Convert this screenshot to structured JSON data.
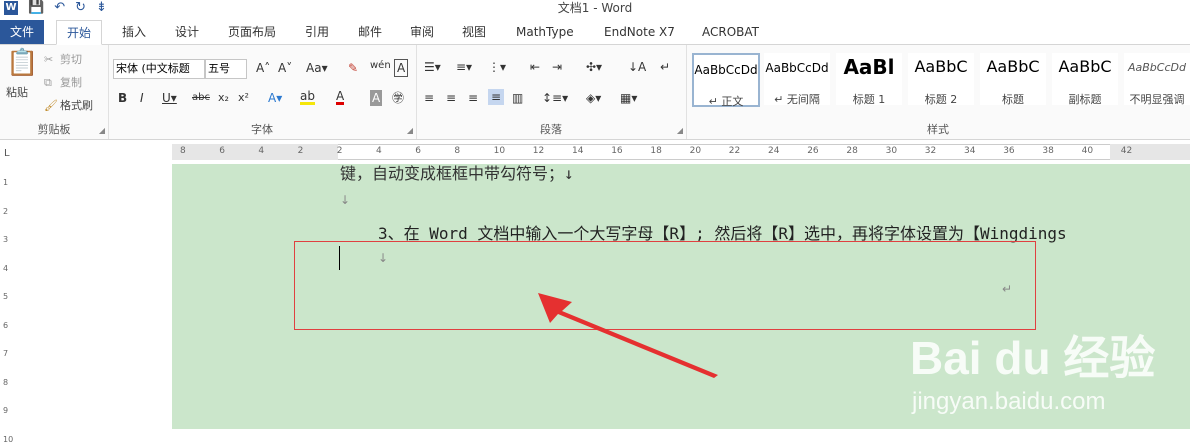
{
  "window": {
    "title": "文档1 - Word"
  },
  "qat": {
    "save": "💾",
    "undo": "↶",
    "redo": "↻",
    "more": "⇟"
  },
  "tabs": [
    {
      "label": "文件"
    },
    {
      "label": "开始"
    },
    {
      "label": "插入"
    },
    {
      "label": "设计"
    },
    {
      "label": "页面布局"
    },
    {
      "label": "引用"
    },
    {
      "label": "邮件"
    },
    {
      "label": "审阅"
    },
    {
      "label": "视图"
    },
    {
      "label": "MathType"
    },
    {
      "label": "EndNote X7"
    },
    {
      "label": "ACROBAT"
    }
  ],
  "clipboard": {
    "paste": "粘贴",
    "cut": "剪切",
    "copy": "复制",
    "format_painter": "格式刷",
    "group": "剪贴板"
  },
  "font": {
    "name": "宋体 (中文标题",
    "size": "五号",
    "group": "字体"
  },
  "paragraph": {
    "group": "段落"
  },
  "styles": {
    "group": "样式",
    "items": [
      {
        "sample": "AaBbCcDd",
        "name": "↵ 正文"
      },
      {
        "sample": "AaBbCcDd",
        "name": "↵ 无间隔"
      },
      {
        "sample": "AaBl",
        "name": "标题 1"
      },
      {
        "sample": "AaBbC",
        "name": "标题 2"
      },
      {
        "sample": "AaBbC",
        "name": "标题"
      },
      {
        "sample": "AaBbC",
        "name": "副标题"
      },
      {
        "sample": "AaBbCcDd",
        "name": "不明显强调"
      }
    ]
  },
  "ruler": {
    "h_ticks": [
      "8",
      "6",
      "4",
      "2",
      "2",
      "4",
      "6",
      "8",
      "10",
      "12",
      "14",
      "16",
      "18",
      "20",
      "22",
      "24",
      "26",
      "28",
      "30",
      "32",
      "34",
      "36",
      "38",
      "40",
      "42"
    ],
    "v_ticks": [
      "1",
      "2",
      "3",
      "4",
      "5",
      "6",
      "7",
      "8",
      "9",
      "10"
    ]
  },
  "document": {
    "line1": "键，自动变成框框中带勾符号；↓",
    "mark1": "↓",
    "line3": "3、在 Word 文档中输入一个大写字母【R】; 然后将【R】选中，再将字体设置为【Wingdings",
    "mark3": "↓",
    "mark4": "↵"
  },
  "watermark": {
    "main": "Bai du 经验",
    "sub": "jingyan.baidu.com"
  }
}
